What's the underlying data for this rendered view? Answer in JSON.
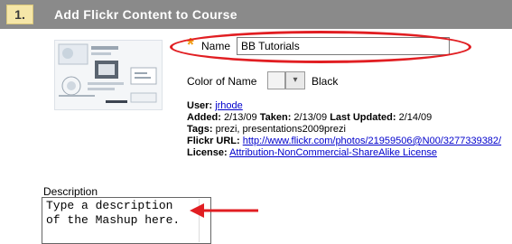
{
  "step": {
    "number": "1.",
    "title": "Add Flickr Content to Course"
  },
  "thumbnail": {
    "icon": "flickr-photo-thumbnail"
  },
  "name_field": {
    "required_marker": "*",
    "label": "Name",
    "value": "BB Tutorials"
  },
  "color_field": {
    "label": "Color of Name",
    "value": "Black",
    "dropdown_glyph": "▾"
  },
  "details": {
    "user_label": "User:",
    "user_value": "jrhode",
    "added_label": "Added:",
    "added_value": "2/13/09",
    "taken_label": "Taken:",
    "taken_value": "2/13/09",
    "updated_label": "Last Updated:",
    "updated_value": "2/14/09",
    "tags_label": "Tags:",
    "tags_value": "prezi, presentations2009prezi",
    "url_label": "Flickr URL:",
    "url_value": "http://www.flickr.com/photos/21959506@N00/3277339382/",
    "license_label": "License:",
    "license_value": "Attribution-NonCommercial-ShareAlike License"
  },
  "description": {
    "label": "Description",
    "value": "Type a description\nof the Mashup here."
  },
  "colors": {
    "header_bg": "#8a8a8a",
    "step_badge": "#f5e6a8",
    "required_star": "#f09a10",
    "annotation_red": "#e11e22",
    "link": "#0000cc"
  }
}
